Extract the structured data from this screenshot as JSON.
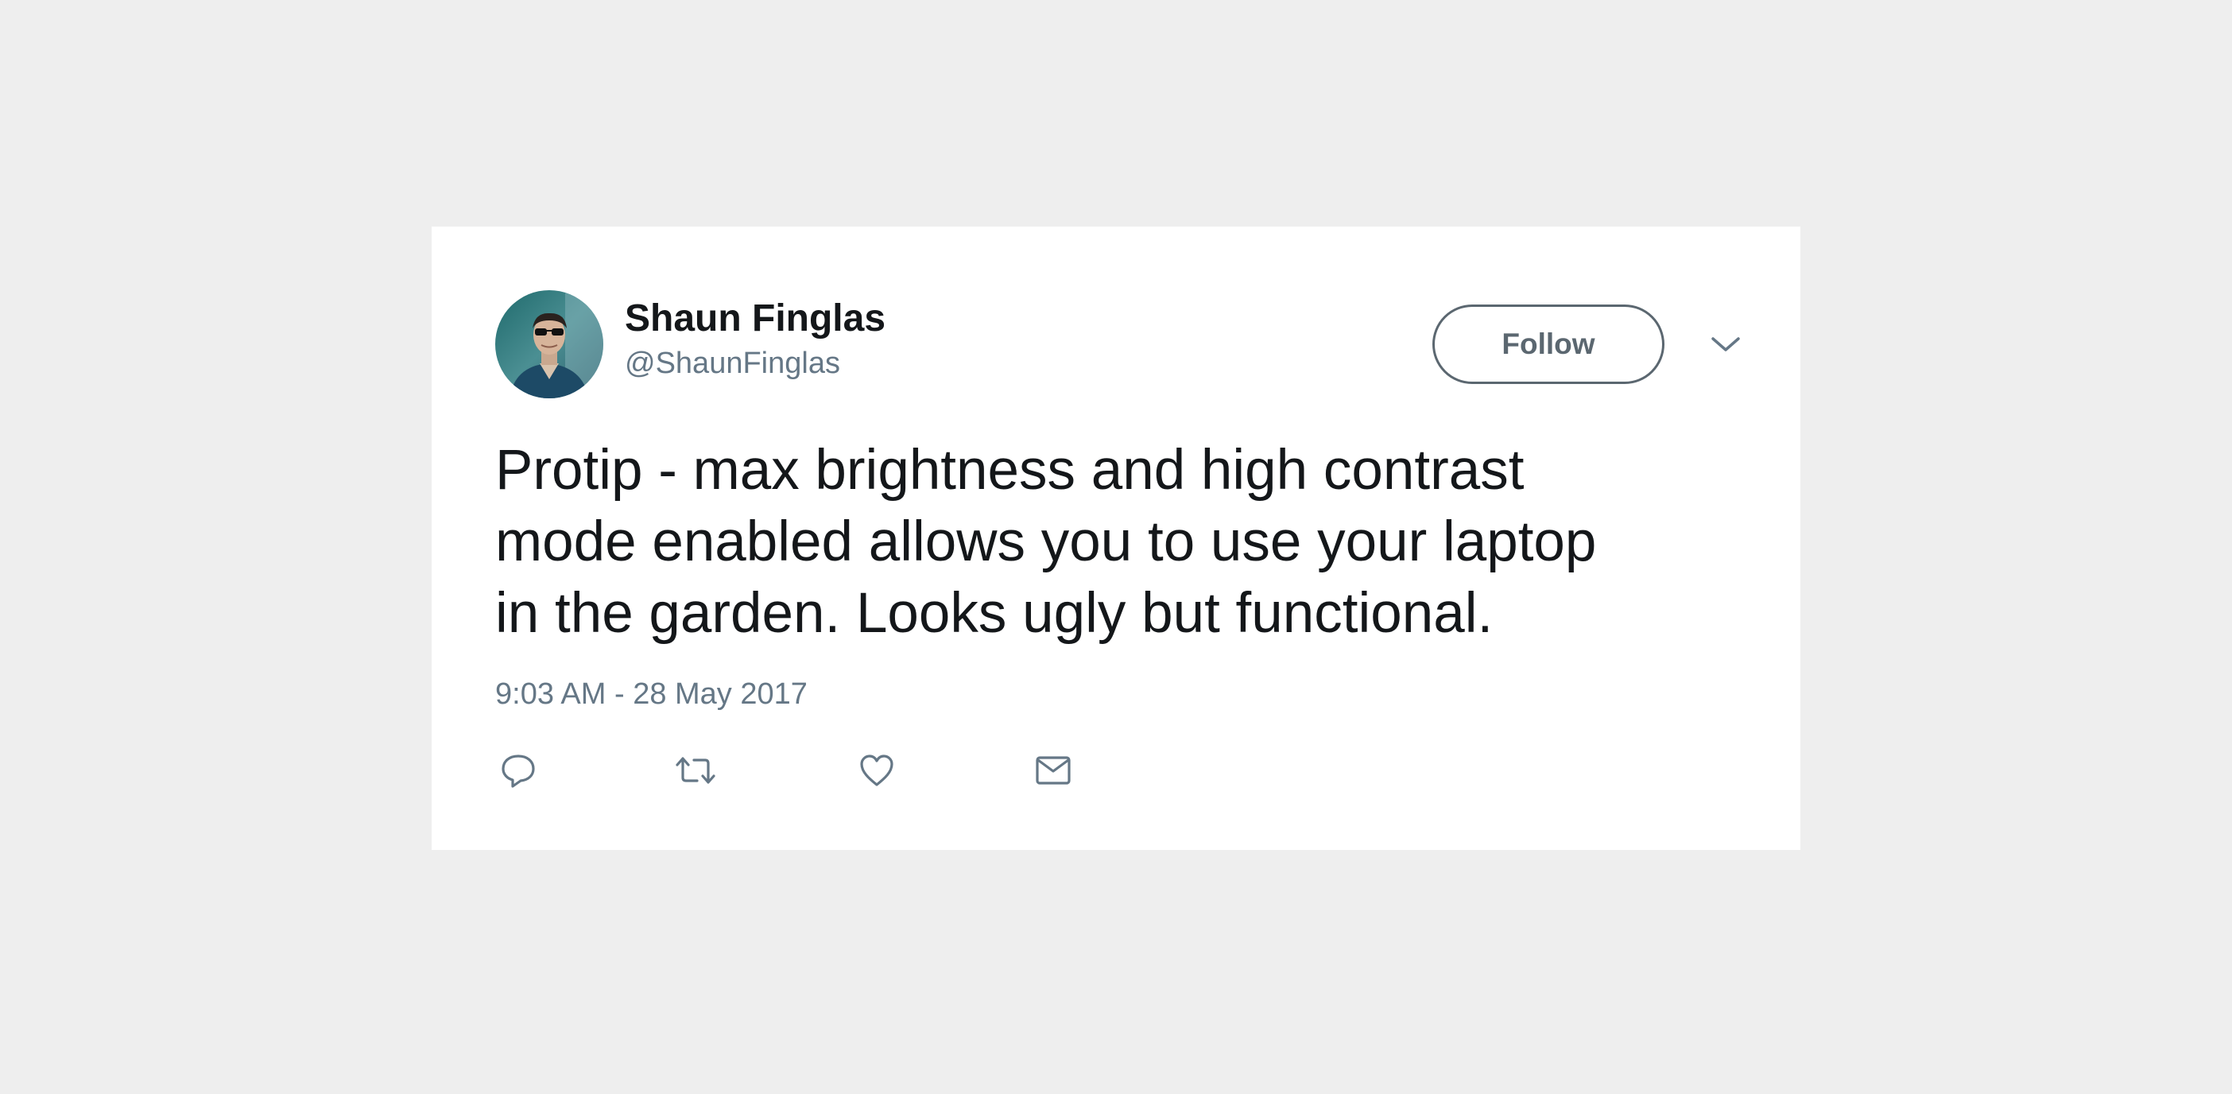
{
  "tweet": {
    "author": {
      "display_name": "Shaun Finglas",
      "handle": "@ShaunFinglas"
    },
    "follow_label": "Follow",
    "text": "Protip - max brightness and high contrast\nmode enabled allows you to use your laptop\nin the garden. Looks ugly but functional.",
    "timestamp": "9:03 AM - 28 May 2017",
    "actions": [
      {
        "icon": "reply-icon"
      },
      {
        "icon": "retweet-icon"
      },
      {
        "icon": "heart-icon"
      },
      {
        "icon": "envelope-icon"
      }
    ]
  },
  "colors": {
    "page_background": "#eeeeee",
    "card_background": "#ffffff",
    "primary_text": "#14171a",
    "secondary_text": "#657786",
    "button_border": "#5b6770"
  }
}
